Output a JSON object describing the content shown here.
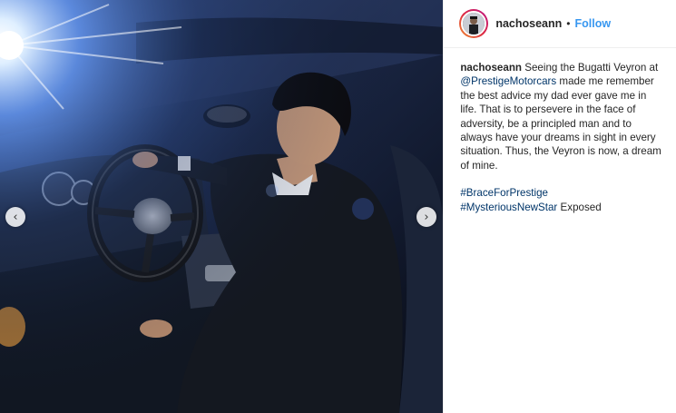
{
  "post": {
    "username": "nachoseann",
    "separator": "•",
    "follow_label": "Follow",
    "caption": {
      "before_mention": "Seeing the Bugatti Veyron at ",
      "mention": "@PrestigeMotorcars",
      "after_mention": " made me remember the best advice my dad ever gave me in life. That is to persevere in the face of adversity, be a principled man and to always have your dreams in sight in every situation. Thus, the Veyron is now, a dream of mine.",
      "hashtag_1": "#BraceForPrestige",
      "hashtag_2": "#MysteriousNewStar",
      "after_hashtags": " Exposed"
    }
  },
  "media": {
    "prev_icon": "chevron-left-icon",
    "next_icon": "chevron-right-icon",
    "prev_glyph": "‹",
    "next_glyph": "›"
  },
  "colors": {
    "link": "#003569",
    "follow": "#3897f0",
    "text": "#262626"
  }
}
